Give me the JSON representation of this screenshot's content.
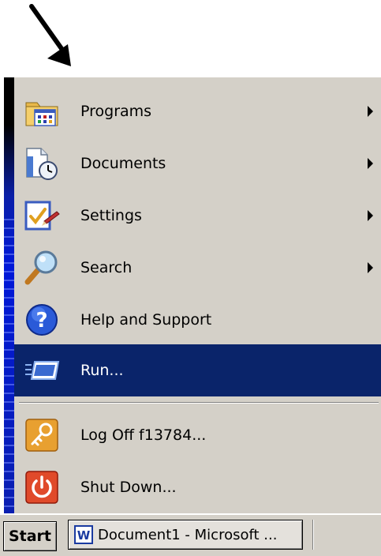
{
  "menu": {
    "items": [
      {
        "label": "Programs",
        "icon": "programs-folder-icon",
        "submenu": true
      },
      {
        "label": "Documents",
        "icon": "documents-icon",
        "submenu": true
      },
      {
        "label": "Settings",
        "icon": "settings-icon",
        "submenu": true
      },
      {
        "label": "Search",
        "icon": "search-magnifier-icon",
        "submenu": true
      },
      {
        "label": "Help and Support",
        "icon": "help-icon",
        "submenu": false
      },
      {
        "label": "Run...",
        "icon": "run-icon",
        "submenu": false,
        "selected": true
      },
      {
        "label": "Log Off f13784...",
        "icon": "key-icon",
        "submenu": false
      },
      {
        "label": "Shut Down...",
        "icon": "power-icon",
        "submenu": false
      }
    ]
  },
  "taskbar": {
    "start_label": "Start",
    "task_label": "Document1 - Microsoft ...",
    "task_icon": "word-icon"
  },
  "colors": {
    "selection": "#0a246a",
    "menu_bg": "#d4d0c8",
    "side_stripe": "#0018d8"
  }
}
